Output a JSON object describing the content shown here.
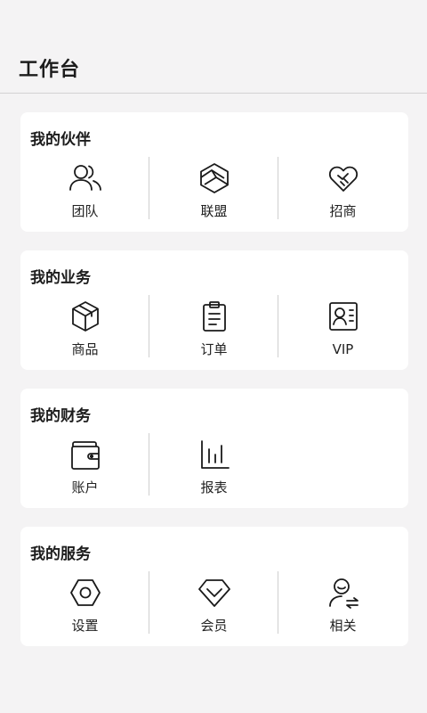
{
  "header": {
    "title": "工作台"
  },
  "sections": [
    {
      "title": "我的伙伴",
      "items": [
        {
          "label": "团队",
          "icon": "team-icon"
        },
        {
          "label": "联盟",
          "icon": "alliance-icon"
        },
        {
          "label": "招商",
          "icon": "recruit-icon"
        }
      ]
    },
    {
      "title": "我的业务",
      "items": [
        {
          "label": "商品",
          "icon": "product-box-icon"
        },
        {
          "label": "订单",
          "icon": "order-clipboard-icon"
        },
        {
          "label": "VIP",
          "icon": "vip-card-icon"
        }
      ]
    },
    {
      "title": "我的财务",
      "items": [
        {
          "label": "账户",
          "icon": "wallet-icon"
        },
        {
          "label": "报表",
          "icon": "bar-chart-icon"
        }
      ]
    },
    {
      "title": "我的服务",
      "items": [
        {
          "label": "设置",
          "icon": "settings-hex-icon"
        },
        {
          "label": "会员",
          "icon": "diamond-icon"
        },
        {
          "label": "相关",
          "icon": "user-switch-icon"
        }
      ]
    }
  ]
}
